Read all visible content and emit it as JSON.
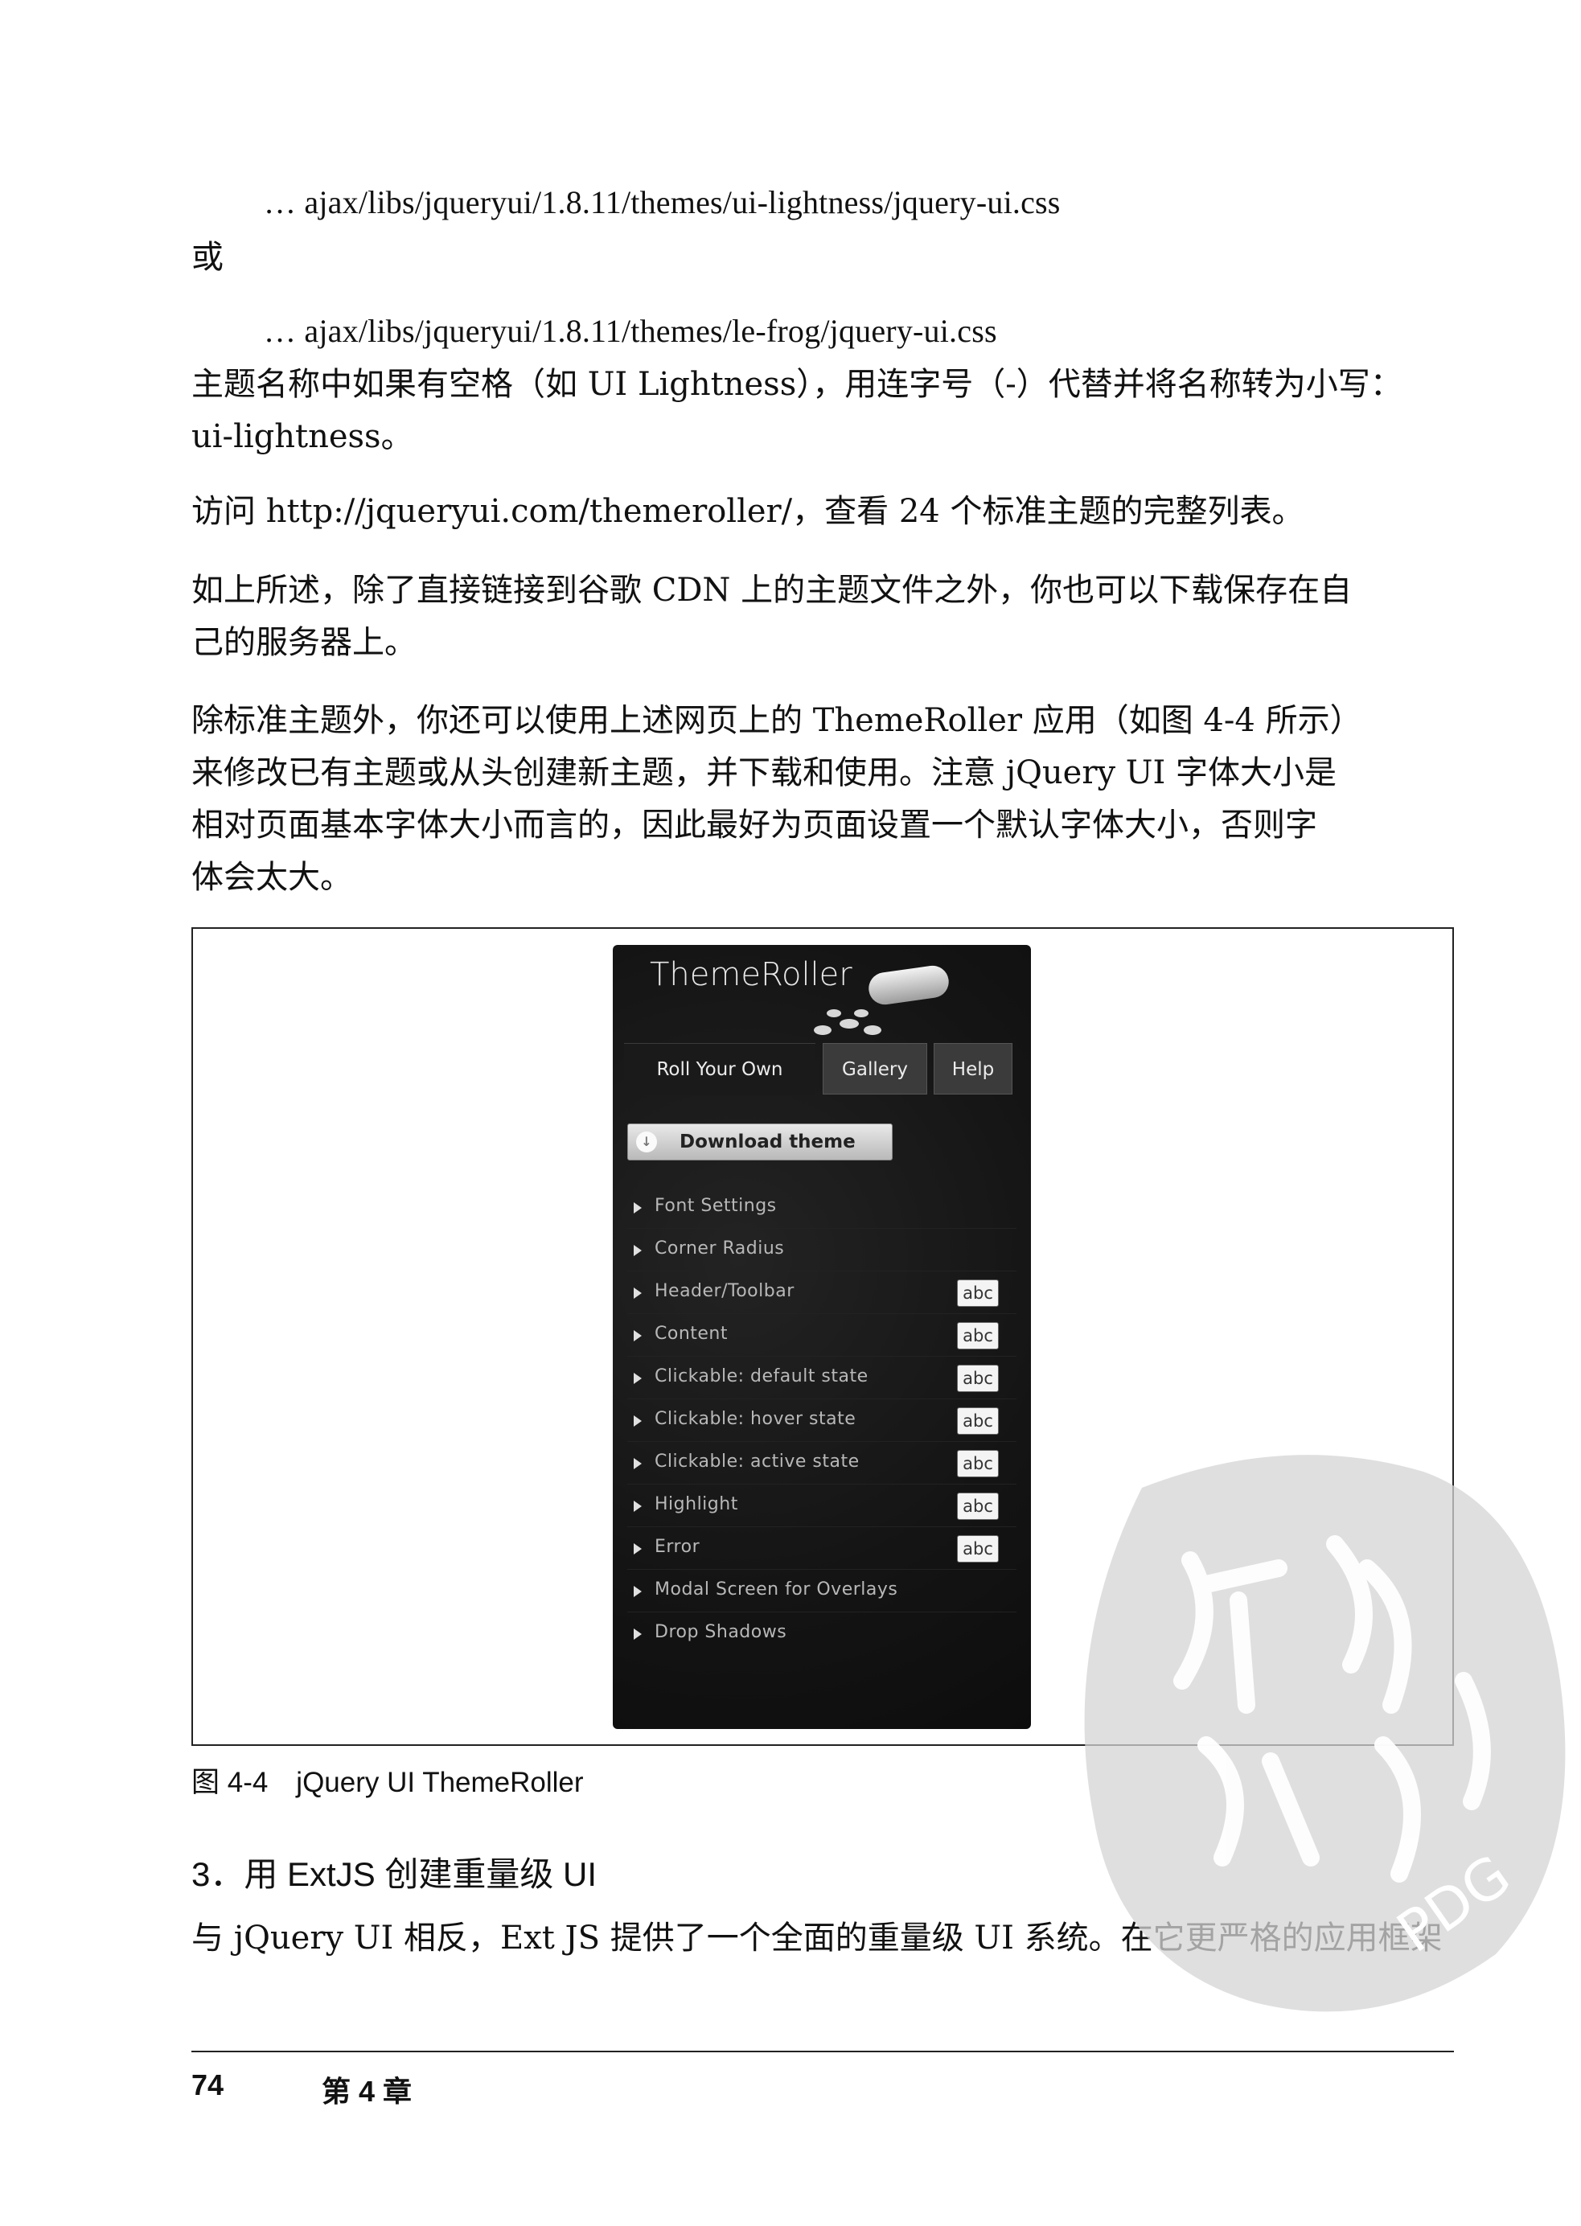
{
  "body": {
    "code_line_1": "… ajax/libs/jqueryui/1.8.11/themes/ui-lightness/jquery-ui.css",
    "or_word": "或",
    "code_line_2": "… ajax/libs/jqueryui/1.8.11/themes/le-frog/jquery-ui.css",
    "para1": [
      "主题名称中如果有空格（如 UI Lightness），用连字号（-）代替并将名称转为小写：",
      "ui-lightness。"
    ],
    "para2": [
      "访问 http://jqueryui.com/themeroller/，查看 24 个标准主题的完整列表。"
    ],
    "para3": [
      "如上所述，除了直接链接到谷歌 CDN 上的主题文件之外，你也可以下载保存在自",
      "己的服务器上。"
    ],
    "para4": [
      "除标准主题外，你还可以使用上述网页上的 ThemeRoller 应用（如图 4-4 所示）",
      "来修改已有主题或从头创建新主题，并下载和使用。注意 jQuery UI 字体大小是",
      "相对页面基本字体大小而言的，因此最好为页面设置一个默认字体大小，否则字",
      "体会太大。"
    ],
    "figure_caption": "图 4-4　jQuery UI ThemeRoller",
    "section_heading": "3．用 ExtJS 创建重量级 UI",
    "para5": [
      "与 jQuery UI 相反，Ext JS 提供了一个全面的重量级 UI 系统。在它更严格的应用框架"
    ]
  },
  "themeroller": {
    "title": "ThemeRoller",
    "tabs": [
      "Roll Your Own",
      "Gallery",
      "Help"
    ],
    "download_label": "Download theme",
    "rows": [
      {
        "label": "Font Settings",
        "abc": ""
      },
      {
        "label": "Corner Radius",
        "abc": ""
      },
      {
        "label": "Header/Toolbar",
        "abc": "abc"
      },
      {
        "label": "Content",
        "abc": "abc"
      },
      {
        "label": "Clickable: default state",
        "abc": "abc"
      },
      {
        "label": "Clickable: hover state",
        "abc": "abc"
      },
      {
        "label": "Clickable: active state",
        "abc": "abc"
      },
      {
        "label": "Highlight",
        "abc": "abc"
      },
      {
        "label": "Error",
        "abc": "abc"
      },
      {
        "label": "Modal Screen for Overlays",
        "abc": ""
      },
      {
        "label": "Drop Shadows",
        "abc": ""
      }
    ]
  },
  "footer": {
    "page_number": "74",
    "chapter": "第 4 章"
  },
  "watermark": {
    "text": "PDG"
  }
}
